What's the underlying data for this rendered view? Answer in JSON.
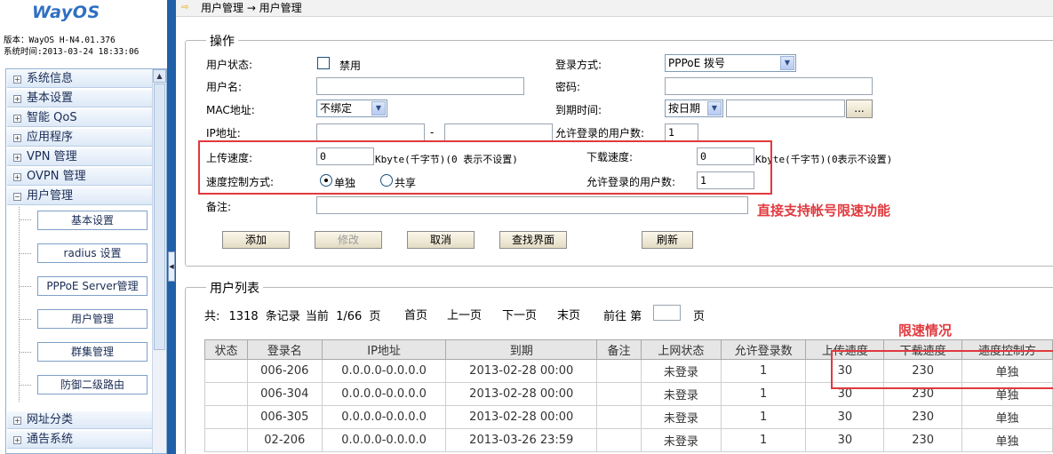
{
  "sidebar": {
    "logo": "WayOS",
    "version": "版本：WayOS H-N4.01.376",
    "system_time": "系统时间:2013-03-24 18:33:06",
    "menu_top": [
      "系统信息",
      "基本设置",
      "智能 QoS",
      "应用程序",
      "VPN 管理",
      "OVPN 管理",
      "用户管理"
    ],
    "sub_items": [
      "基本设置",
      "radius 设置",
      "PPPoE Server管理",
      "用户管理",
      "群集管理",
      "防御二级路由"
    ],
    "menu_bottom": [
      "网址分类",
      "通告系统"
    ]
  },
  "breadcrumb": "用户管理 → 用户管理",
  "ops": {
    "legend": "操作",
    "user_status_label": "用户状态:",
    "disable_label": "禁用",
    "login_method_label": "登录方式:",
    "login_method_value": "PPPoE 拨号",
    "username_label": "用户名:",
    "username_value": "",
    "password_label": "密码:",
    "password_value": "",
    "mac_label": "MAC地址:",
    "mac_value": "不绑定",
    "expire_label": "到期时间:",
    "expire_mode": "按日期",
    "expire_value": "",
    "browse_button": "...",
    "ip_label": "IP地址:",
    "ip_dash": "-",
    "ip_start": "",
    "ip_end": "",
    "allow_login_label": "允许登录的用户数:",
    "allow_login_value": "1",
    "upload_label": "上传速度:",
    "upload_value": "0",
    "upload_unit": "Kbyte(千字节)(0 表示不设置)",
    "download_label": "下载速度:",
    "download_value": "0",
    "download_unit": "Kbyte(千字节)(0表示不设置)",
    "speed_mode_label": "速度控制方式:",
    "speed_mode_single": "单独",
    "speed_mode_shared": "共享",
    "allow_login_label2": "允许登录的用户数:",
    "allow_login_value2": "1",
    "remark_label": "备注:",
    "remark_value": "",
    "buttons": [
      "添加",
      "修改",
      "取消",
      "查找界面",
      "刷新"
    ]
  },
  "annotations": {
    "speed_feature": "直接支持帐号限速功能",
    "speed_status": "限速情况"
  },
  "list": {
    "legend": "用户列表",
    "total_prefix": "共:",
    "total_count": "1318",
    "total_suffix": "条记录",
    "current_label": "当前",
    "current_page": "1/66",
    "page_unit": "页",
    "first": "首页",
    "prev": "上一页",
    "next": "下一页",
    "last": "末页",
    "goto_prefix": "前往 第",
    "goto_value": "",
    "goto_suffix": "页",
    "headers": [
      "状态",
      "登录名",
      "IP地址",
      "到期",
      "备注",
      "上网状态",
      "允许登录数",
      "上传速度",
      "下载速度",
      "速度控制方"
    ],
    "rows": [
      [
        "",
        "006-206",
        "0.0.0.0-0.0.0.0",
        "2013-02-28 00:00",
        "",
        "未登录",
        "1",
        "30",
        "230",
        "单独"
      ],
      [
        "",
        "006-304",
        "0.0.0.0-0.0.0.0",
        "2013-02-28 00:00",
        "",
        "未登录",
        "1",
        "30",
        "230",
        "单独"
      ],
      [
        "",
        "006-305",
        "0.0.0.0-0.0.0.0",
        "2013-02-28 00:00",
        "",
        "未登录",
        "1",
        "30",
        "230",
        "单独"
      ],
      [
        "",
        "02-206",
        "0.0.0.0-0.0.0.0",
        "2013-03-26 23:59",
        "",
        "未登录",
        "1",
        "30",
        "230",
        "单独"
      ]
    ]
  },
  "colors": {
    "accent_blue": "#2060a8",
    "annotation_red": "#e0393e"
  }
}
